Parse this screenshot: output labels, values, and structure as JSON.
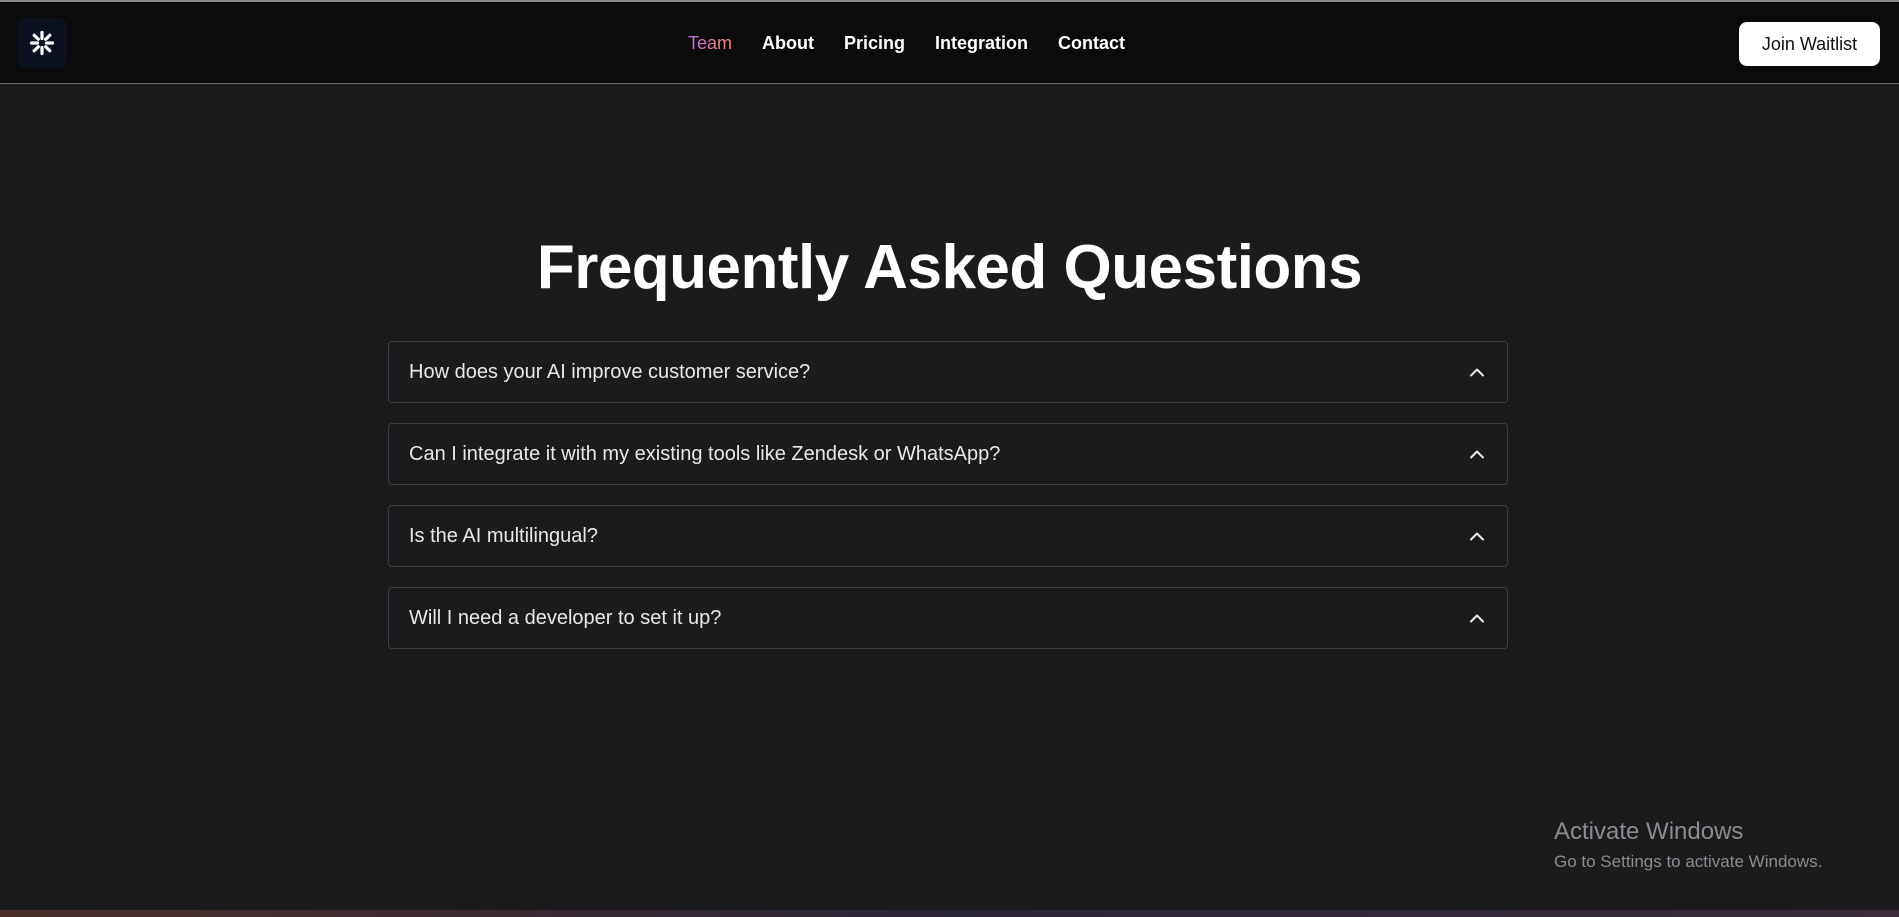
{
  "nav": {
    "logo_icon": "sparkle-burst-icon",
    "links": [
      "Team",
      "About",
      "Pricing",
      "Integration",
      "Contact"
    ],
    "active_link": "Team",
    "cta_label": "Join Waitlist"
  },
  "faq": {
    "title": "Frequently Asked Questions",
    "items": [
      {
        "question": "How does your AI improve customer service?"
      },
      {
        "question": "Can I integrate it with my existing tools like Zendesk or WhatsApp?"
      },
      {
        "question": "Is the AI multilingual?"
      },
      {
        "question": "Will I need a developer to set it up?"
      }
    ],
    "toggle_icon": "chevron-up-icon"
  },
  "watermark": {
    "title": "Activate Windows",
    "subtitle": "Go to Settings to activate Windows."
  },
  "colors": {
    "background": "#1b1b1d",
    "navbar": "#0b0b0c",
    "accent_gradient_start": "#c06cf0",
    "accent_gradient_end": "#ff8a5b",
    "button_bg": "#ffffff"
  }
}
